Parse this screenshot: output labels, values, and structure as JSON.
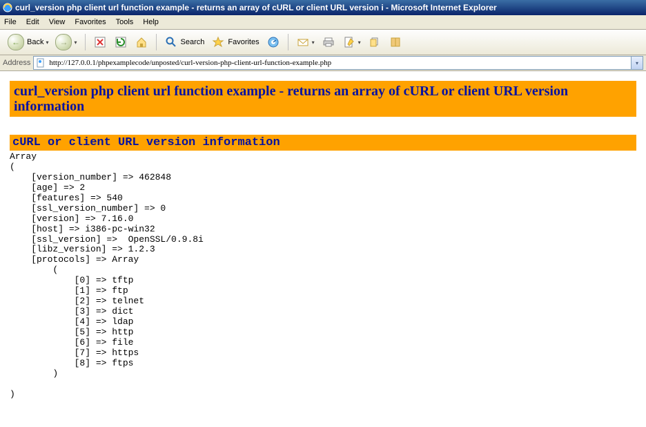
{
  "window": {
    "title": "curl_version php client url function example - returns an array of cURL or client URL version i - Microsoft Internet Explorer"
  },
  "menu": {
    "file": "File",
    "edit": "Edit",
    "view": "View",
    "favorites": "Favorites",
    "tools": "Tools",
    "help": "Help"
  },
  "toolbar": {
    "back": "Back",
    "search": "Search",
    "favorites": "Favorites"
  },
  "address": {
    "label": "Address",
    "value": "http://127.0.0.1/phpexamplecode/unposted/curl-version-php-client-url-function-example.php"
  },
  "page": {
    "heading": "curl_version php client url function example - returns an array of cURL or client URL version information",
    "subheading": "cURL or client URL version information",
    "array_dump": "Array\n(\n    [version_number] => 462848\n    [age] => 2\n    [features] => 540\n    [ssl_version_number] => 0\n    [version] => 7.16.0\n    [host] => i386-pc-win32\n    [ssl_version] =>  OpenSSL/0.9.8i\n    [libz_version] => 1.2.3\n    [protocols] => Array\n        (\n            [0] => tftp\n            [1] => ftp\n            [2] => telnet\n            [3] => dict\n            [4] => ldap\n            [5] => http\n            [6] => file\n            [7] => https\n            [8] => ftps\n        )\n\n)"
  }
}
